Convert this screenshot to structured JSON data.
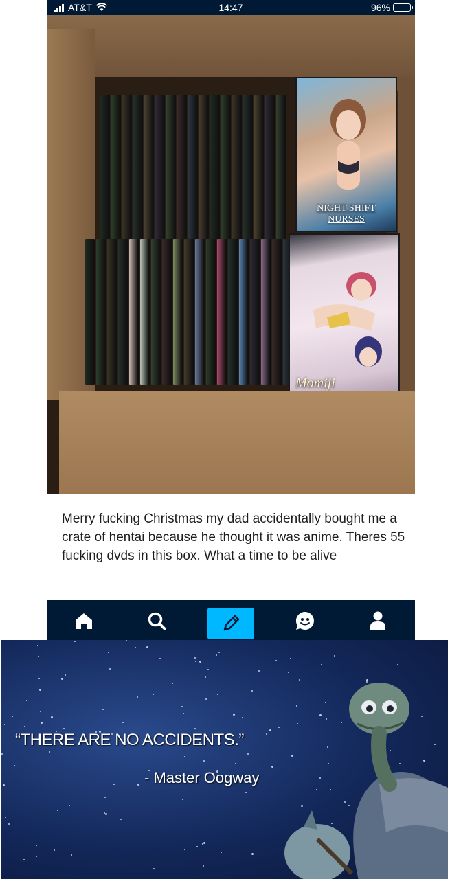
{
  "status_bar": {
    "carrier": "AT&T",
    "time": "14:47",
    "battery": "96%",
    "battery_level": 0.96
  },
  "post": {
    "photo": {
      "cover_titles": [
        "NIGHT SHIFT NURSES",
        "Momiji"
      ]
    },
    "caption": "Merry fucking Christmas my dad accidentally bought me a crate of hentai because he thought it was anime. Theres 55 fucking dvds in this box. What a time to be alive"
  },
  "nav": {
    "items": [
      {
        "name": "home",
        "icon": "home-icon"
      },
      {
        "name": "search",
        "icon": "search-icon"
      },
      {
        "name": "compose",
        "icon": "pencil-icon"
      },
      {
        "name": "activity",
        "icon": "smiley-icon"
      },
      {
        "name": "account",
        "icon": "user-icon"
      }
    ],
    "bar_color": "#001935",
    "compose_color": "#00b8ff"
  },
  "meme": {
    "quote": "“THERE ARE NO ACCIDENTS.”",
    "attribution": "- Master Oogway"
  }
}
